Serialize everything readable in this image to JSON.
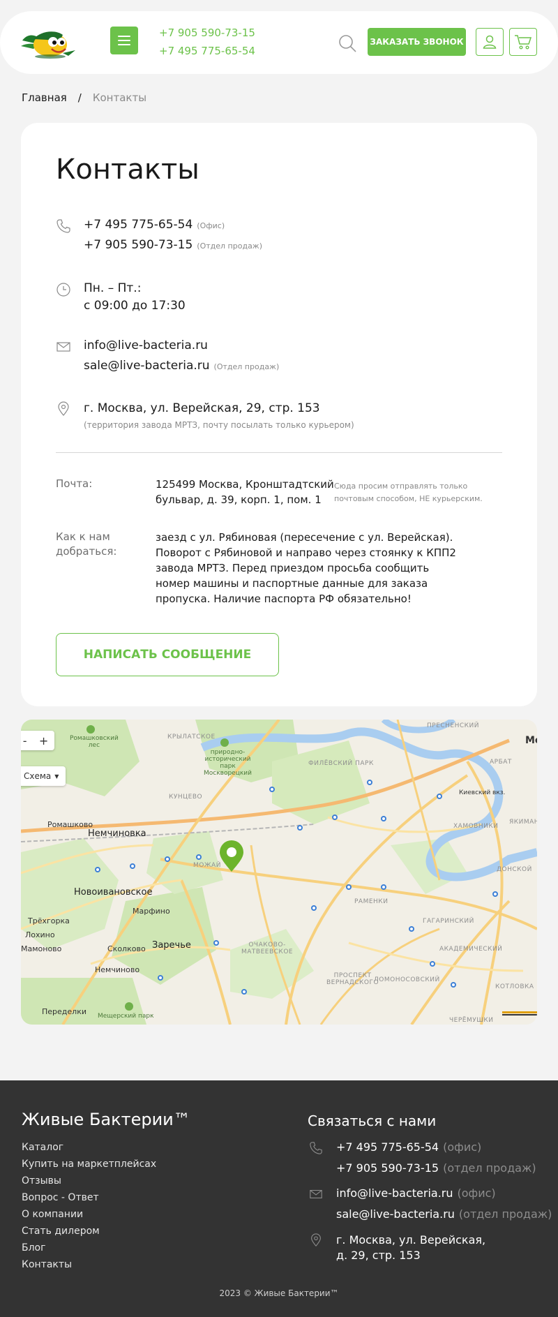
{
  "header": {
    "phone1": "+7 905 590-73-15",
    "phone2": "+7 495 775-65-54",
    "callback_label": "ЗАКАЗАТЬ ЗВОНОК"
  },
  "breadcrumb": {
    "home": "Главная",
    "separator": "/",
    "current": "Контакты"
  },
  "contacts": {
    "title": "Контакты",
    "phone_office": "+7 495 775-65-54",
    "phone_office_note": "(Офис)",
    "phone_sales": "+7 905 590-73-15",
    "phone_sales_note": "(Отдел продаж)",
    "hours_line1": "Пн. – Пт.:",
    "hours_line2": "с 09:00 до 17:30",
    "email_office": "info@live-bacteria.ru",
    "email_sales": "sale@live-bacteria.ru",
    "email_sales_note": "(Отдел продаж)",
    "address": "г. Москва, ул. Верейская, 29, стр. 153",
    "address_note": "(территория завода МРТЗ, почту посылать только курьером)",
    "post_label": "Почта:",
    "post_line1": "125499 Москва, Кронштадтский",
    "post_line2": "бульвар, д. 39, корп. 1, пом. 1",
    "post_note": "Сюда просим отправлять только почтовым способом, НЕ курьерским.",
    "route_label_line1": "Как к нам",
    "route_label_line2": "добраться:",
    "route_lines": [
      "заезд с ул. Рябиновая (пересечение с ул. Верейская).",
      "Поворот с Рябиновой и направо через стоянку к КПП2",
      "завода МРТЗ. Перед приездом просьба сообщить",
      "номер машины и паспортные данные для заказа",
      "пропуска. Наличие паспорта РФ обязательно!"
    ],
    "message_button": "НАПИСАТЬ СООБЩЕНИЕ"
  },
  "map": {
    "zoom_minus": "-",
    "zoom_plus": "+",
    "scheme_label": "Схема",
    "labels": {
      "nemchinovka": "Немчиновка",
      "novoivanovskoe": "Новоивановское",
      "zarechye": "Заречье",
      "romashkovo": "Ромашково",
      "marfino": "Марфино",
      "skolkovo": "Сколково",
      "nemchinovo": "Немчиново",
      "trekhgorka": "Трёхгорка",
      "lokhino": "Лохино",
      "mamonovo": "Мамоново",
      "peredelki": "Переделки",
      "krylatskoe": "КРЫЛАТСКОЕ",
      "kuntsevo": "КУНЦЕВО",
      "mozhaysky": "МОЖАЙ",
      "filevsky_park": "ФИЛЁВСКИЙ ПАРК",
      "presnensky": "ПРЕСНЕНСКИЙ",
      "arbat": "АРБАТ",
      "yakimanka": "ЯКИМАН",
      "khamovniki": "ХАМОВНИКИ",
      "donskoy": "ДОНСКОЙ",
      "ramenki": "РАМЕНКИ",
      "gagarinsky": "ГАГАРИНСКИЙ",
      "akademichesky": "АКАДЕМИЧЕСКИЙ",
      "ochakovo": "ОЧАКОВО-\nМАТВЕЕВСКОЕ",
      "prospekt_vernadskogo": "ПРОСПЕКТ\nВЕРНАДСКОГО",
      "lomonosovsky": "ЛОМОНОСОВСКИЙ",
      "kotlovka": "КОТЛОВКА",
      "cheremushki": "ЧЕРЁМУШКИ",
      "kievsky": "Киевский вкз.",
      "romashkovsky_les": "Ромашковский\nлес",
      "moskvoretsky_park": "природно-\nисторический\nпарк\nМосквoрецкий",
      "meshchersky_park": "Мещерский парк",
      "moscow_short": "Мо"
    }
  },
  "footer": {
    "brand": "Живые Бактерии™",
    "links": [
      "Каталог",
      "Купить на маркетплейсах",
      "Отзывы",
      "Вопрос - Ответ",
      "О компании",
      "Стать дилером",
      "Блог",
      "Контакты"
    ],
    "contact_title": "Связаться с нами",
    "phone_office": "+7 495 775-65-54",
    "phone_office_note": "(офис)",
    "phone_sales": "+7 905 590-73-15",
    "phone_sales_note": "(отдел продаж)",
    "email_office": "info@live-bacteria.ru",
    "email_office_note": "(офис)",
    "email_sales": "sale@live-bacteria.ru",
    "email_sales_note": "(отдел продаж)",
    "address": "г. Москва, ул. Верейская, д. 29, стр. 153",
    "copyright": "2023 © Живые Бактерии™"
  },
  "colors": {
    "accent": "#6cc24a",
    "footer_bg": "#333333",
    "page_bg": "#f3f3f3"
  }
}
